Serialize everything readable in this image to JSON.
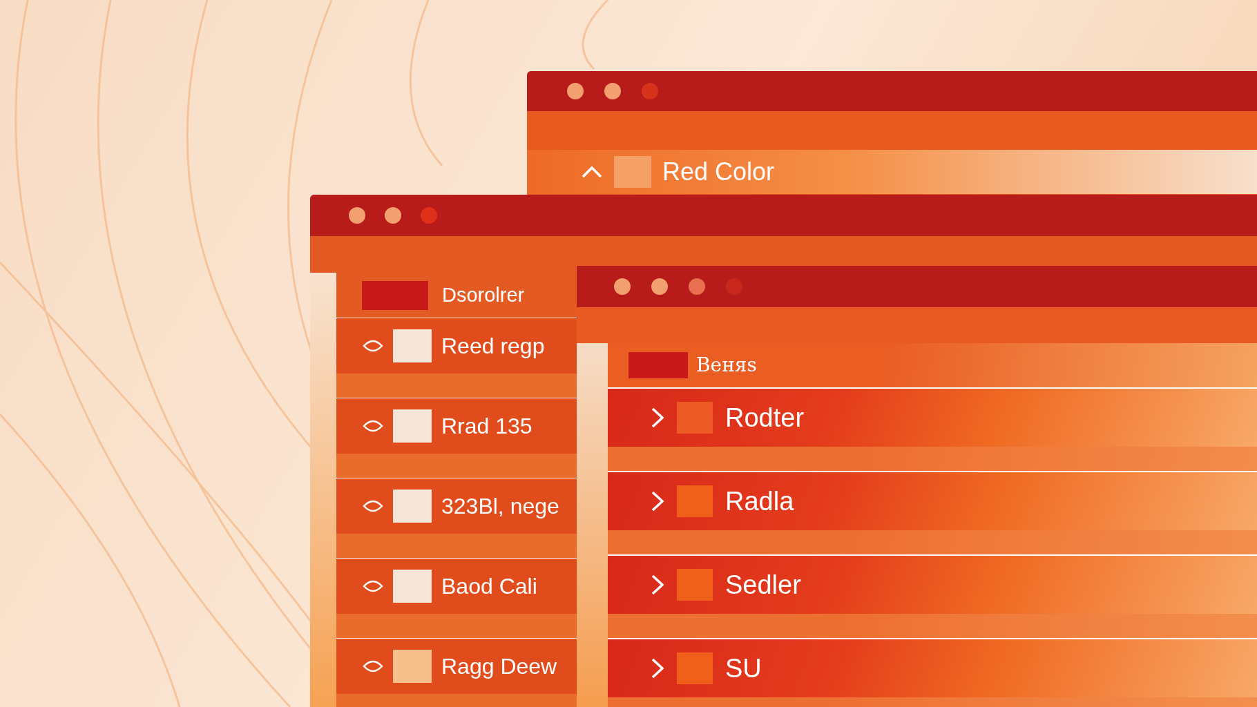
{
  "windows": [
    {
      "kind": "header",
      "dots": [
        {
          "color": "#f2a070"
        },
        {
          "color": "#f2a070"
        },
        {
          "color": "#d8321c"
        }
      ],
      "rows": [
        {
          "label": "Red Color",
          "color": "#f5a066"
        }
      ]
    },
    {
      "kind": "layers",
      "dots": [
        {
          "color": "#f2a070"
        },
        {
          "color": "#f2a070"
        },
        {
          "color": "#e0301a"
        }
      ],
      "header": {
        "label": "Dsorolrer",
        "color": "#c8181a"
      },
      "rows": [
        {
          "label": "Reed regp",
          "color": "#f5e6d8"
        },
        {
          "label": "Rrad 135",
          "color": "#f5e6d8"
        },
        {
          "label": "323Bl, nege",
          "color": "#f5e6d8"
        },
        {
          "label": "Baod Cali",
          "color": "#f5e6d8"
        },
        {
          "label": "Ragg Deew",
          "color": "#f6c08c"
        }
      ]
    },
    {
      "kind": "tree",
      "dots": [
        {
          "color": "#f2a070"
        },
        {
          "color": "#f2a070"
        },
        {
          "color": "#e87050"
        },
        {
          "color": "#c8281c"
        }
      ],
      "header": {
        "label": "Beняs",
        "color": "#c8181a"
      },
      "rows": [
        {
          "label": "Rodter",
          "color": "#ee5a24"
        },
        {
          "label": "Radla",
          "color": "#f0601a"
        },
        {
          "label": "Sedler",
          "color": "#f0601a"
        },
        {
          "label": "SU",
          "color": "#f0601a"
        }
      ]
    }
  ]
}
